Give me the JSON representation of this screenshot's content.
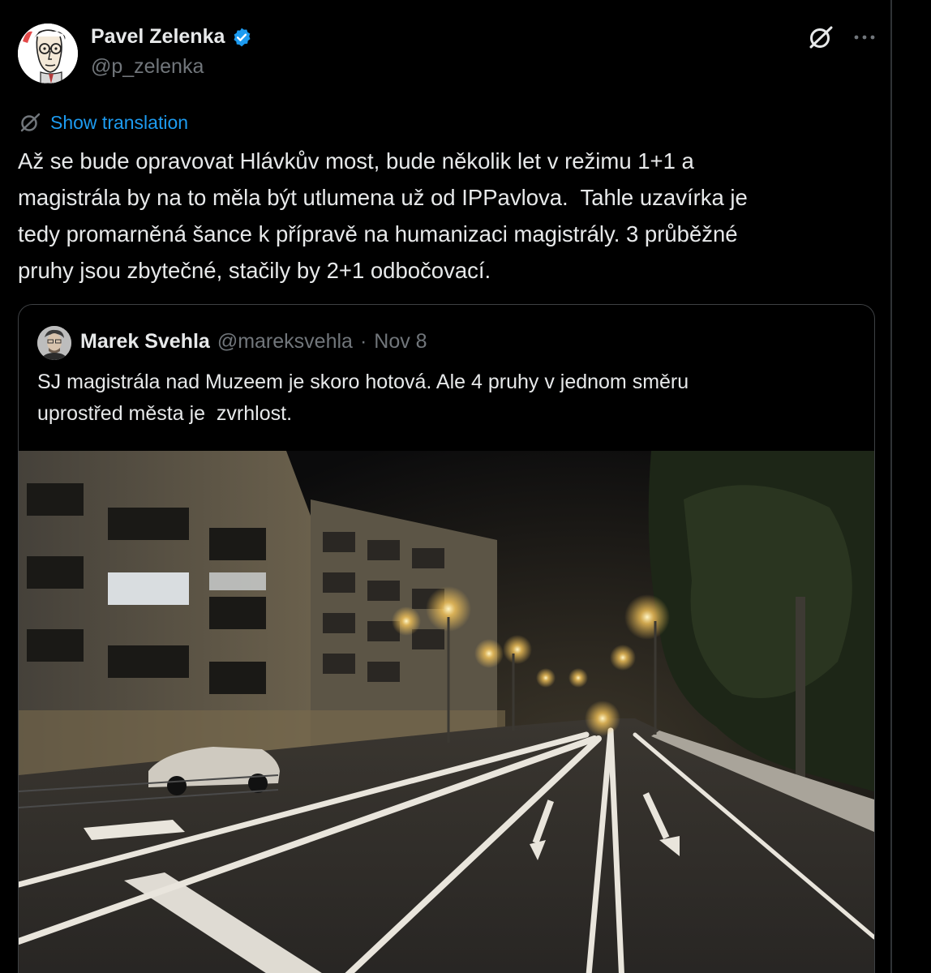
{
  "post": {
    "author": {
      "name": "Pavel Zelenka",
      "handle": "@p_zelenka",
      "verified": true,
      "avatar_icon": "caricature-avatar"
    },
    "header_icons": [
      "grok-icon",
      "more-options-icon"
    ],
    "translation_link": "Show translation",
    "text": "Až se bude opravovat Hlávkův most, bude několik let v režimu 1+1 a\nmagistrála by na to měla být utlumena už od IPPavlova.  Tahle uzavírka je\ntedy promarněná šance k přípravě na humanizaci magistrály. 3 průběžné\npruhy jsou zbytečné, stačily by 2+1 odbočovací."
  },
  "quote": {
    "author_name": "Marek Svehla",
    "handle": "@mareksvehla",
    "separator": "·",
    "date": "Nov 8",
    "text": "SJ magistrála nad Muzeem je skoro hotová. Ale 4 pruhy v jednom směru\nuprostřed města je  zvrhlost.",
    "photo_icon": "night-street-photo"
  },
  "colors": {
    "background": "#000000",
    "text_primary": "#e7e9ea",
    "text_secondary": "#71767b",
    "link": "#1d9bf0",
    "verified_badge": "#1d9bf0",
    "border": "#2f3336"
  }
}
